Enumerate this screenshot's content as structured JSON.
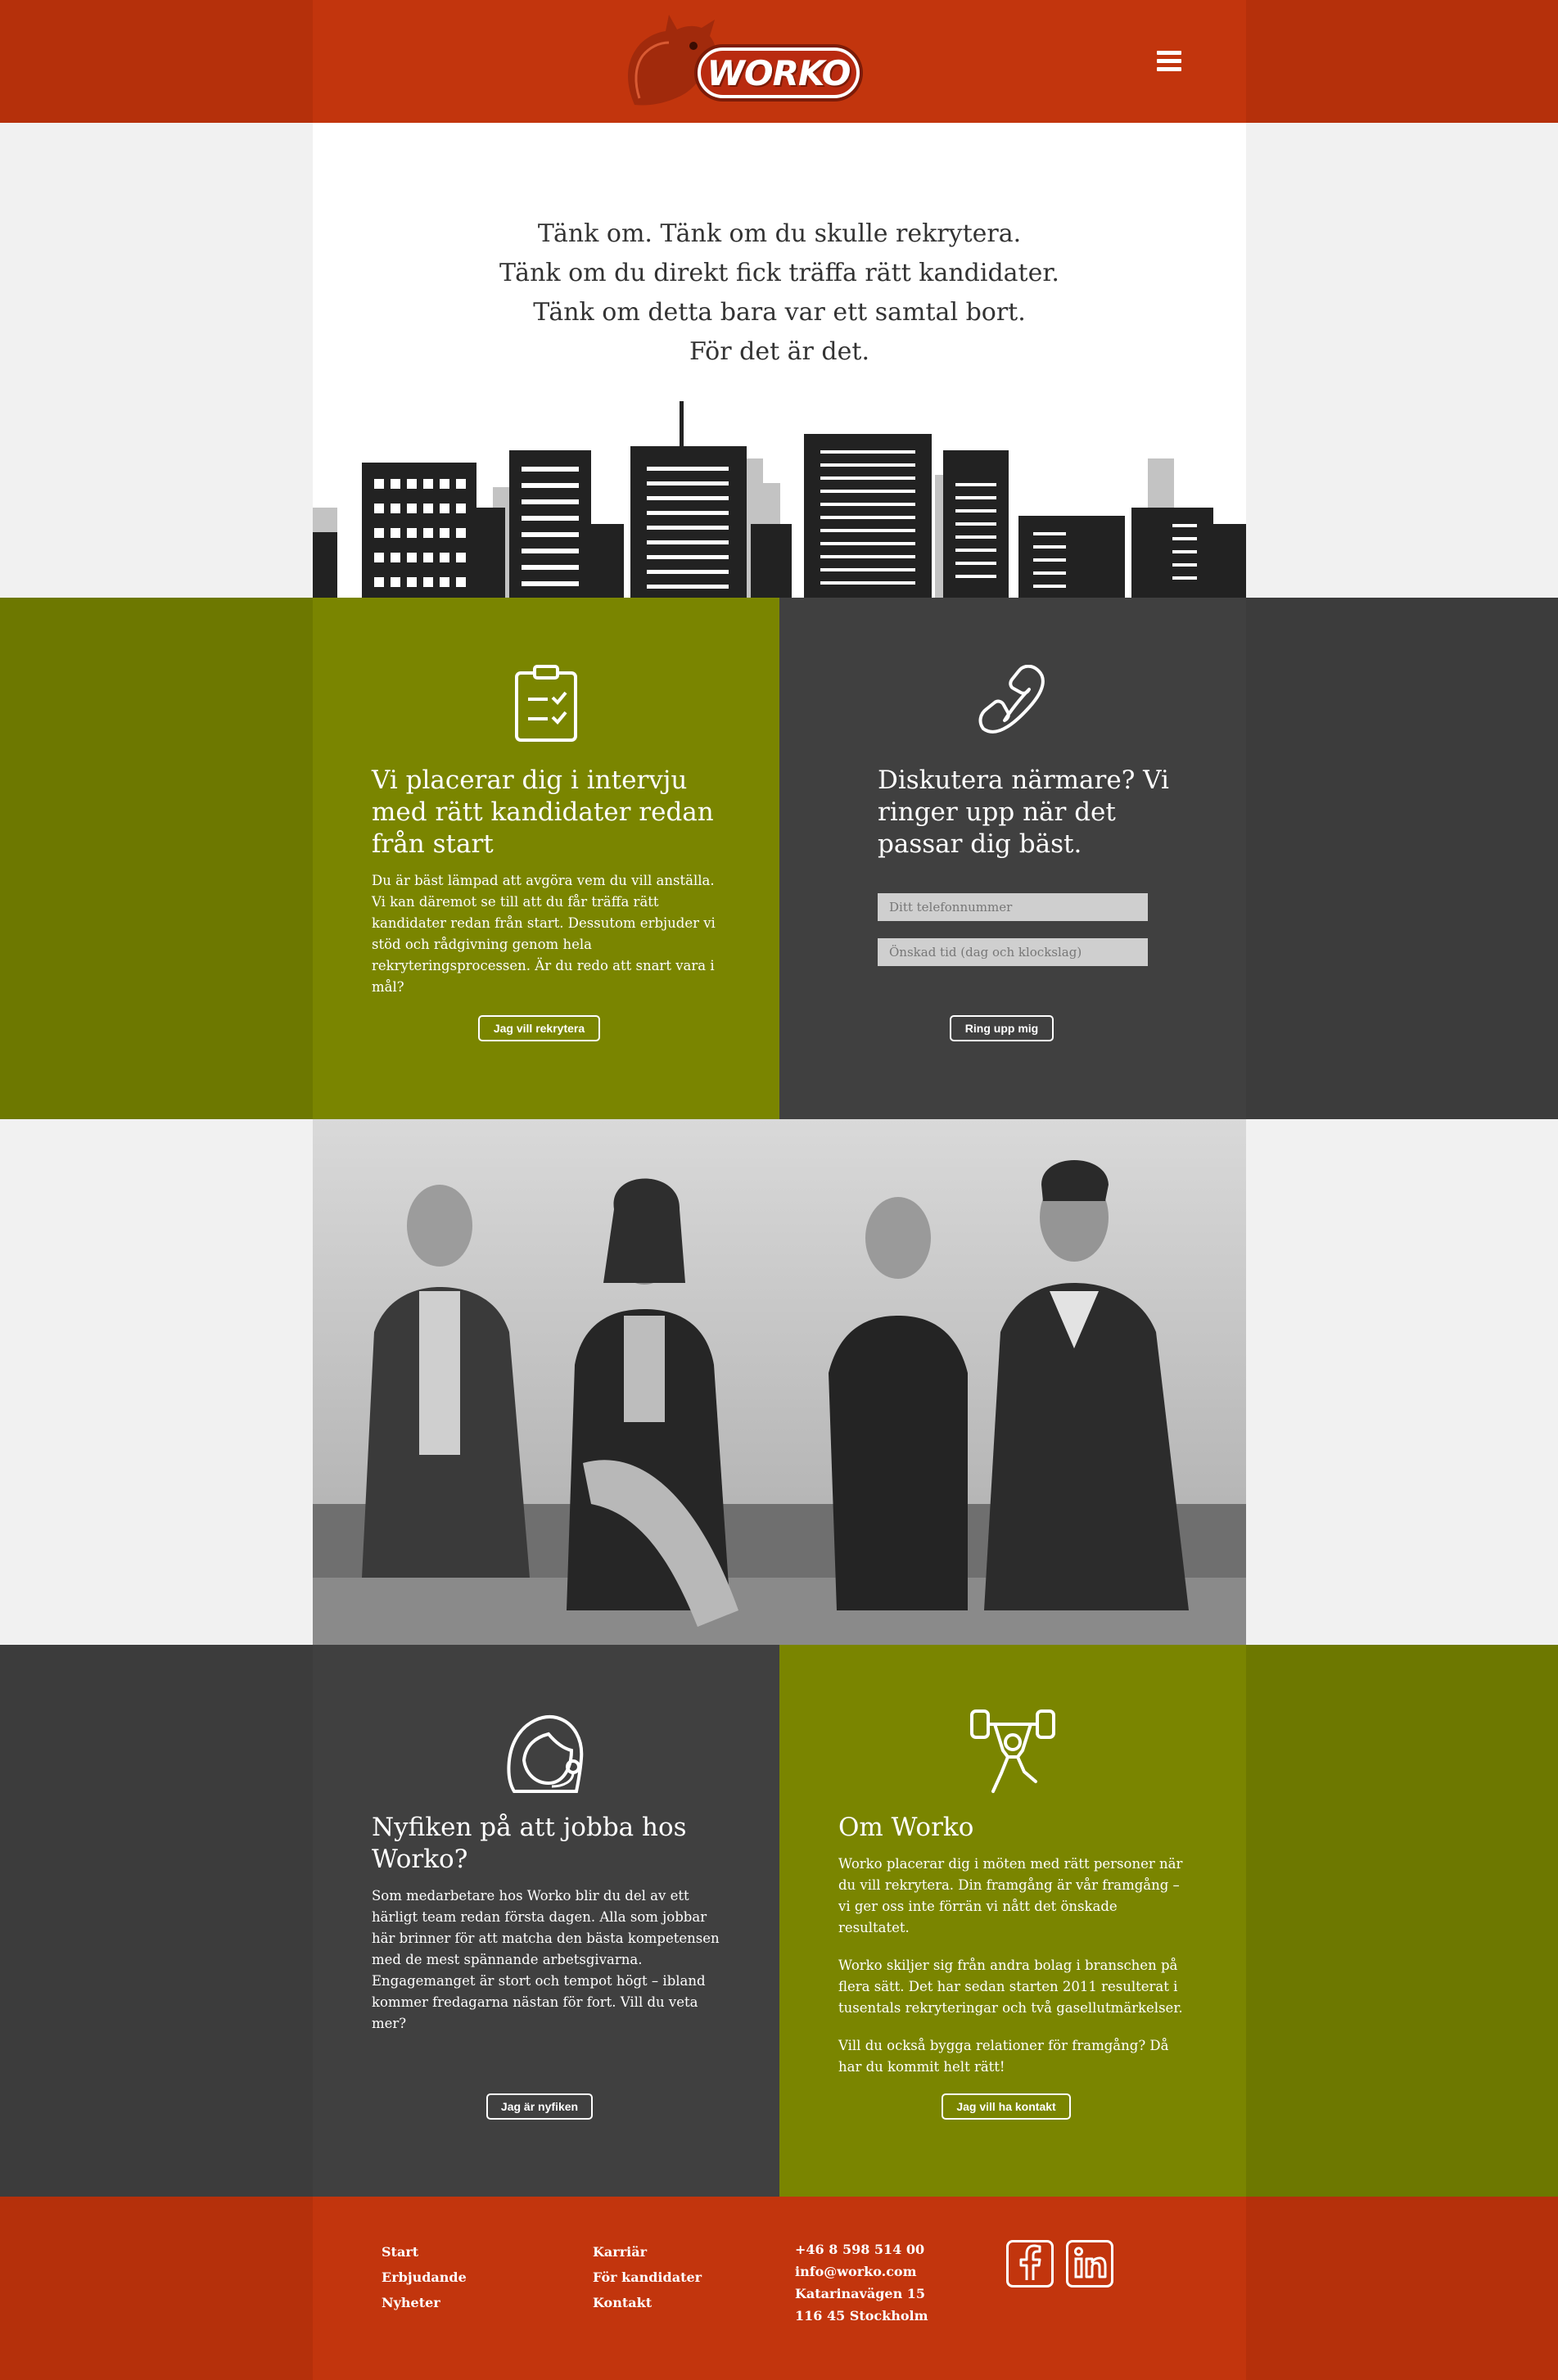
{
  "header": {
    "logo_text": "WORKO",
    "menu_icon": "hamburger-menu-icon"
  },
  "hero": {
    "lines": [
      "Tänk om. Tänk om du skulle rekrytera.",
      "Tänk om du direkt fick träffa rätt kandidater.",
      "Tänk om detta bara var ett samtal bort.",
      "För det är det."
    ]
  },
  "recruit": {
    "icon": "clipboard-checklist-icon",
    "title": "Vi placerar dig i intervju med rätt kandidater redan från start",
    "body": "Du är bäst lämpad att avgöra vem du vill anställa. Vi kan däremot se till att du får träffa rätt kandidater redan från start. Dessutom erbjuder vi stöd och rådgivning genom hela rekryteringsprocessen. Är du redo att snart vara i mål?",
    "button": "Jag vill rekrytera"
  },
  "call": {
    "icon": "phone-icon",
    "title": "Diskutera närmare? Vi ringer upp när det passar dig bäst.",
    "phone_placeholder": "Ditt telefonnummer",
    "time_placeholder": "Önskad tid (dag och klockslag)",
    "button": "Ring upp mig"
  },
  "careers": {
    "icon": "headset-person-icon",
    "title": "Nyfiken på att jobba hos Worko?",
    "body": "Som medarbetare hos Worko blir du del av ett härligt team redan första dagen. Alla som jobbar här brinner för att matcha den bästa kompetensen med de mest spännande arbetsgivarna. Engagemanget är stort och tempot högt – ibland kommer fredagarna nästan för fort. Vill du veta mer?",
    "button": "Jag är nyfiken"
  },
  "about": {
    "icon": "weightlifter-icon",
    "title": "Om Worko",
    "paragraphs": [
      "Worko placerar dig i möten med rätt personer när du vill rekrytera. Din framgång är vår framgång – vi ger oss inte förrän vi nått det önskade resultatet.",
      "Worko skiljer sig från andra bolag i branschen på flera sätt. Det har sedan starten 2011 resulterat i tusentals rekryteringar och två gasellutmärkelser.",
      "Vill du också bygga relationer för framgång? Då har du kommit helt rätt!"
    ],
    "button": "Jag vill ha kontakt"
  },
  "footer": {
    "col1": [
      "Start",
      "Erbjudande",
      "Nyheter"
    ],
    "col2": [
      "Karriär",
      "För kandidater",
      "Kontakt"
    ],
    "contact": [
      "+46 8 598 514 00",
      "info@worko.com",
      "Katarinavägen 15",
      "116 45 Stockholm"
    ],
    "social": [
      "facebook-icon",
      "linkedin-icon"
    ]
  },
  "colors": {
    "brand_red": "#c2350d",
    "olive": "#7a8500",
    "charcoal": "#404040"
  }
}
